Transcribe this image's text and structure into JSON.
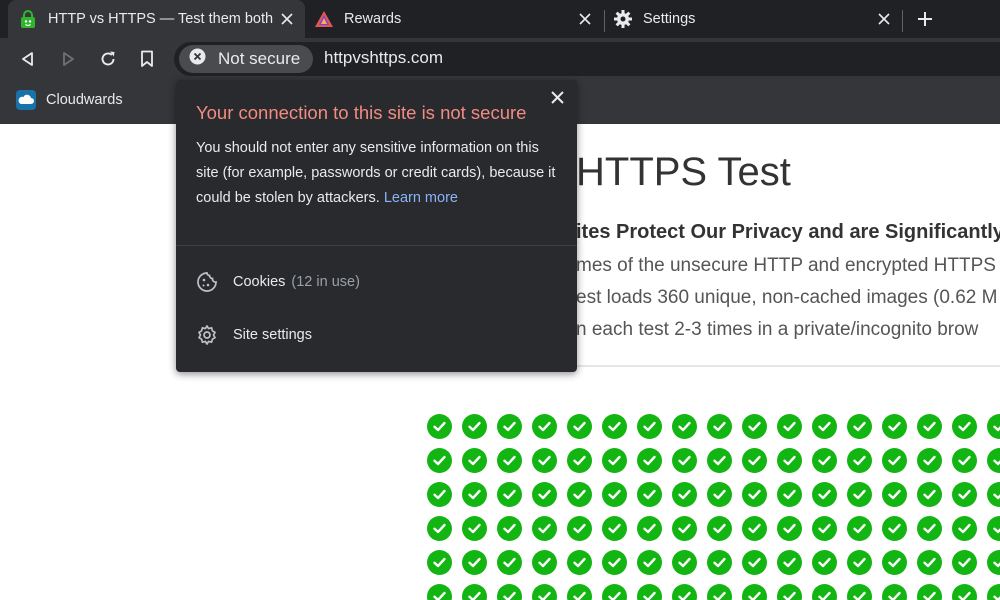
{
  "tabs": [
    {
      "title": "HTTP vs HTTPS — Test them both yourself",
      "favicon": "green-lock-robot-icon",
      "active": true
    },
    {
      "title": "Rewards",
      "favicon": "brave-rewards-triangle-icon",
      "active": false
    },
    {
      "title": "Settings",
      "favicon": "gear-icon",
      "active": false
    }
  ],
  "toolbar": {
    "security_chip": "Not secure",
    "url": "httpvshttps.com"
  },
  "bookmarks": [
    {
      "label": "Cloudwards",
      "icon": "cloud-icon"
    }
  ],
  "page": {
    "title_fragment": "HTTPS Test",
    "subhead_fragment": "ites Protect Our Privacy and are Significantly",
    "lines": [
      "mes of the unsecure HTTP and encrypted HTTPS",
      "est loads 360 unique, non-cached images (0.62 M",
      "n each test 2-3 times in a private/incognito brow"
    ],
    "check_icon": "check-circle-icon",
    "check_color": "#12b512"
  },
  "popup": {
    "heading": "Your connection to this site is not secure",
    "body": "You should not enter any sensitive information on this site (for example, passwords or credit cards), because it could be stolen by attackers.",
    "learn_more": "Learn more",
    "cookies_label": "Cookies",
    "cookies_count": "(12 in use)",
    "site_settings_label": "Site settings"
  },
  "colors": {
    "tabstrip": "#202124",
    "toolbar": "#35363a",
    "warning_red": "#f28b82",
    "link_blue": "#8ab4f8"
  }
}
